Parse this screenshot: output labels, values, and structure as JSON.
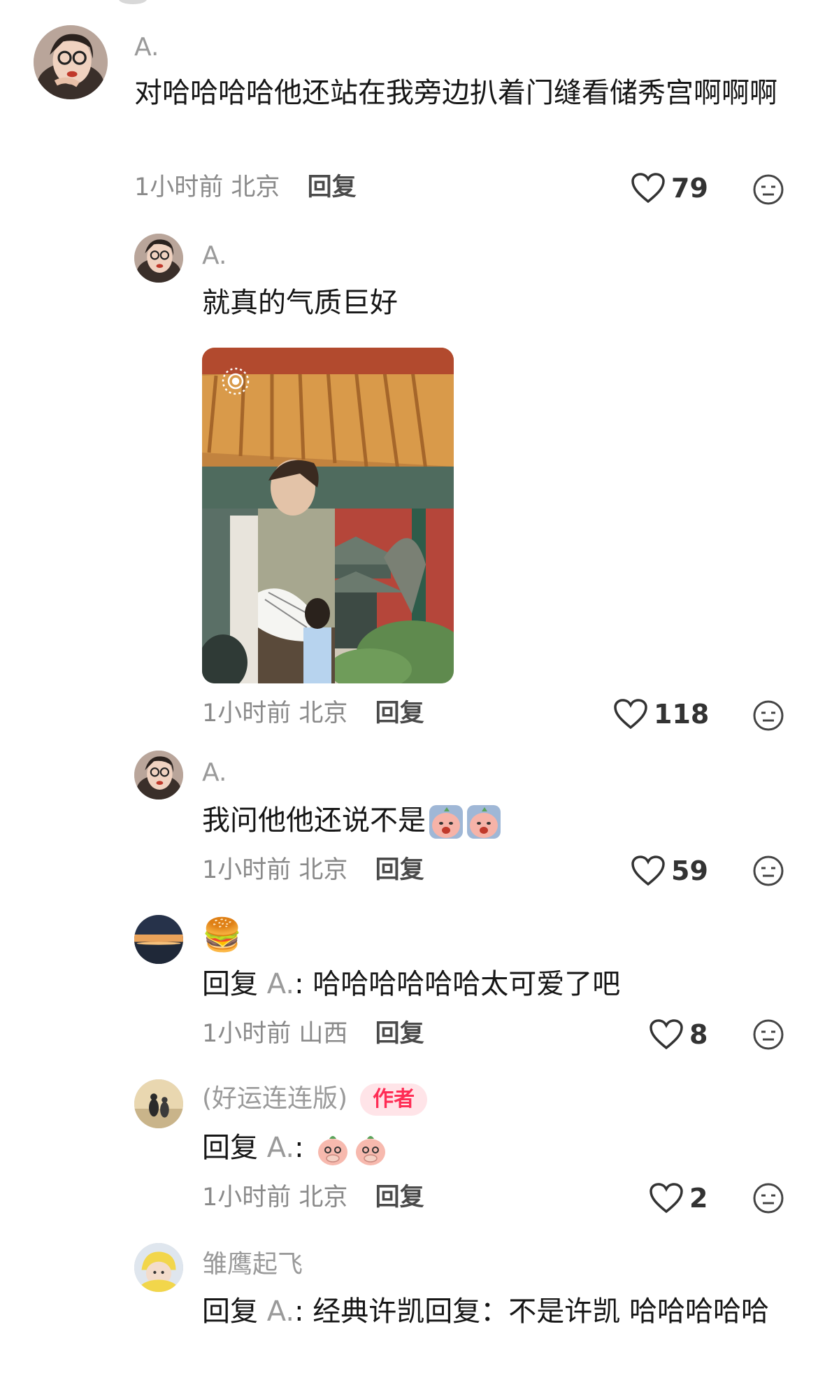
{
  "comments": [
    {
      "author": "A.",
      "text": "对哈哈哈哈他还站在我旁边扒着门缝看储秀宫啊啊啊",
      "time": "1小时前",
      "location": "北京",
      "reply_label": "回复",
      "likes": "79"
    },
    {
      "author": "A.",
      "text": "就真的气质巨好",
      "time": "1小时前",
      "location": "北京",
      "reply_label": "回复",
      "likes": "118"
    },
    {
      "author": "A.",
      "text": "我问他他还说不是",
      "time": "1小时前",
      "location": "北京",
      "reply_label": "回复",
      "likes": "59"
    },
    {
      "author": "🍔",
      "reply_prefix": "回复",
      "mention": "A.",
      "text": ": 哈哈哈哈哈哈太可爱了吧",
      "time": "1小时前",
      "location": "山西",
      "reply_label": "回复",
      "likes": "8"
    },
    {
      "author": "(好运连连版)",
      "badge": "作者",
      "reply_prefix": "回复",
      "mention": "A.",
      "text": ":",
      "time": "1小时前",
      "location": "北京",
      "reply_label": "回复",
      "likes": "2"
    },
    {
      "author": "雏鹰起飞",
      "reply_prefix": "回复",
      "mention": "A.",
      "text": ": 经典许凯回复：不是许凯 哈哈哈哈哈"
    }
  ],
  "icons": {
    "like": "heart-outline-icon",
    "dislike": "neutral-face-icon",
    "live_photo": "live-photo-icon"
  },
  "colors": {
    "badge_bg": "#ffe4e8",
    "badge_text": "#ff2d55",
    "muted_text": "#9a9a9a"
  }
}
